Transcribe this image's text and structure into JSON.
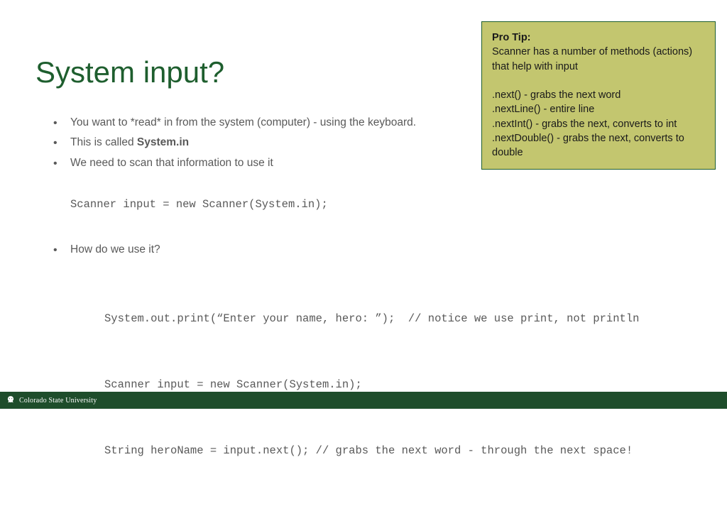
{
  "title": "System input?",
  "bullets": {
    "b1": "You want to *read* in from the system (computer) - using the keyboard.",
    "b2_pre": "This is called ",
    "b2_bold": "System.in",
    "b3": "We need to scan that information to use it",
    "b4": "How do we use it?"
  },
  "code1": "Scanner input = new Scanner(System.in);",
  "code2_lines": {
    "l1": "System.out.print(“Enter your name, hero: ”);  // notice we use print, not println",
    "l2": "Scanner input = new Scanner(System.in);",
    "l3": "String heroName = input.next(); // grabs the next word - through the next space!"
  },
  "tip": {
    "title": "Pro Tip:",
    "line1": "Scanner has a number of methods (actions) that help with input",
    "line2": ".next()  - grabs the next word",
    "line3": ".nextLine() - entire line",
    "line4": ".nextInt()  - grabs the next, converts to int",
    "line5": ".nextDouble() - grabs the next, converts to double"
  },
  "footer": {
    "university": "Colorado State University"
  }
}
